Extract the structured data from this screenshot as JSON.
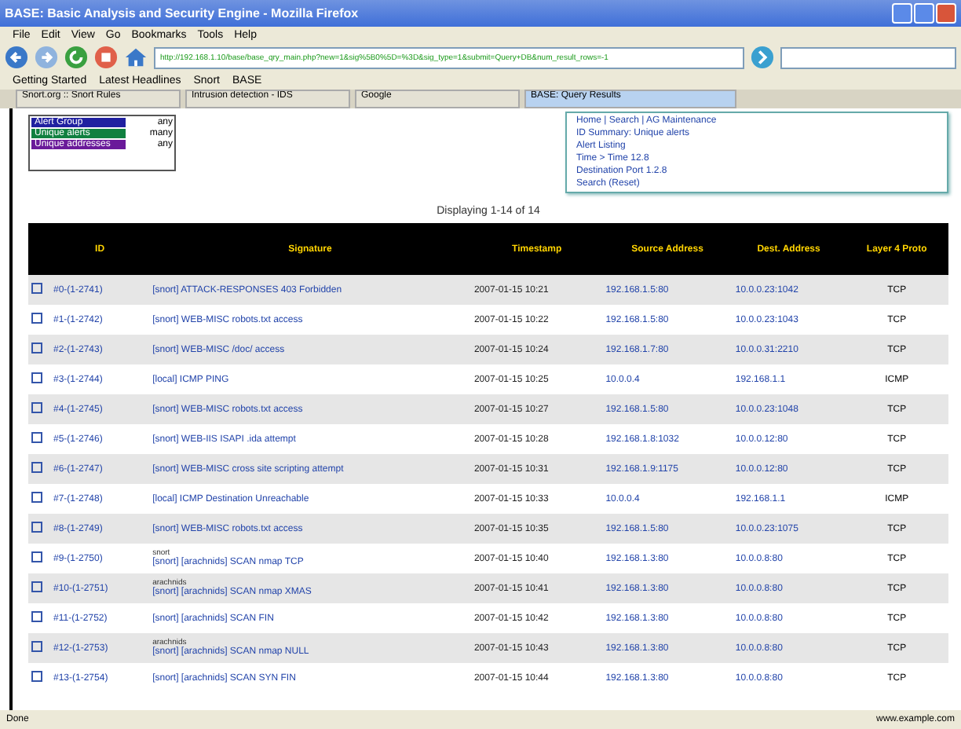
{
  "window": {
    "title": "BASE: Basic Analysis and Security Engine - Mozilla Firefox"
  },
  "menu": [
    "File",
    "Edit",
    "View",
    "Go",
    "Bookmarks",
    "Tools",
    "Help"
  ],
  "address": {
    "value": "http://192.168.1.10/base/base_qry_main.php?new=1&sig%5B0%5D=%3D&sig_type=1&submit=Query+DB&num_result_rows=-1"
  },
  "bookmarks": [
    "Getting Started",
    "Latest Headlines",
    "Snort",
    "BASE"
  ],
  "tabs": [
    {
      "label": "Snort.org :: Snort Rules",
      "selected": false
    },
    {
      "label": "Intrusion detection - IDS",
      "selected": false
    },
    {
      "label": "Google",
      "selected": false
    },
    {
      "label": "BASE: Query Results",
      "selected": true
    }
  ],
  "legend": [
    {
      "label": "Alert Group",
      "value": "any",
      "color": "#2020a0"
    },
    {
      "label": "Unique alerts",
      "value": "many",
      "color": "#108040"
    },
    {
      "label": "Unique addresses",
      "value": "any",
      "color": "#6a1a9a"
    }
  ],
  "nav_links": [
    "Home | Search | AG Maintenance",
    "ID Summary: Unique alerts",
    "Alert Listing",
    "Time > Time 12.8",
    "Destination Port 1.2.8",
    "Search (Reset)"
  ],
  "summary": "Displaying 1-14 of 14",
  "columns": [
    "ID",
    "Signature",
    "Timestamp",
    "Source Address",
    "Dest. Address",
    "Layer 4 Proto"
  ],
  "rows": [
    {
      "checked": false,
      "id": "#0-(1-2741)",
      "note": "",
      "signature": "[snort] ATTACK-RESPONSES 403 Forbidden",
      "timestamp": "2007-01-15 10:21",
      "src": "192.168.1.5:80",
      "dst": "10.0.0.23:1042",
      "proto": "TCP"
    },
    {
      "checked": false,
      "id": "#1-(1-2742)",
      "note": "",
      "signature": "[snort] WEB-MISC robots.txt access",
      "timestamp": "2007-01-15 10:22",
      "src": "192.168.1.5:80",
      "dst": "10.0.0.23:1043",
      "proto": "TCP"
    },
    {
      "checked": false,
      "id": "#2-(1-2743)",
      "note": "",
      "signature": "[snort] WEB-MISC /doc/ access",
      "timestamp": "2007-01-15 10:24",
      "src": "192.168.1.7:80",
      "dst": "10.0.0.31:2210",
      "proto": "TCP"
    },
    {
      "checked": false,
      "id": "#3-(1-2744)",
      "note": "",
      "signature": "[local] ICMP PING",
      "timestamp": "2007-01-15 10:25",
      "src": "10.0.0.4",
      "dst": "192.168.1.1",
      "proto": "ICMP"
    },
    {
      "checked": false,
      "id": "#4-(1-2745)",
      "note": "",
      "signature": "[snort] WEB-MISC robots.txt access",
      "timestamp": "2007-01-15 10:27",
      "src": "192.168.1.5:80",
      "dst": "10.0.0.23:1048",
      "proto": "TCP"
    },
    {
      "checked": false,
      "id": "#5-(1-2746)",
      "note": "",
      "signature": "[snort] WEB-IIS ISAPI .ida attempt",
      "timestamp": "2007-01-15 10:28",
      "src": "192.168.1.8:1032",
      "dst": "10.0.0.12:80",
      "proto": "TCP"
    },
    {
      "checked": false,
      "id": "#6-(1-2747)",
      "note": "",
      "signature": "[snort] WEB-MISC cross site scripting attempt",
      "timestamp": "2007-01-15 10:31",
      "src": "192.168.1.9:1175",
      "dst": "10.0.0.12:80",
      "proto": "TCP"
    },
    {
      "checked": false,
      "id": "#7-(1-2748)",
      "note": "",
      "signature": "[local] ICMP Destination Unreachable",
      "timestamp": "2007-01-15 10:33",
      "src": "10.0.0.4",
      "dst": "192.168.1.1",
      "proto": "ICMP"
    },
    {
      "checked": false,
      "id": "#8-(1-2749)",
      "note": "",
      "signature": "[snort] WEB-MISC robots.txt access",
      "timestamp": "2007-01-15 10:35",
      "src": "192.168.1.5:80",
      "dst": "10.0.0.23:1075",
      "proto": "TCP"
    },
    {
      "checked": false,
      "id": "#9-(1-2750)",
      "note": "snort",
      "signature": "[snort] [arachnids] SCAN nmap TCP",
      "timestamp": "2007-01-15 10:40",
      "src": "192.168.1.3:80",
      "dst": "10.0.0.8:80",
      "proto": "TCP"
    },
    {
      "checked": false,
      "id": "#10-(1-2751)",
      "note": "arachnids",
      "signature": "[snort] [arachnids] SCAN nmap XMAS",
      "timestamp": "2007-01-15 10:41",
      "src": "192.168.1.3:80",
      "dst": "10.0.0.8:80",
      "proto": "TCP"
    },
    {
      "checked": false,
      "id": "#11-(1-2752)",
      "note": "",
      "signature": "[snort] [arachnids] SCAN FIN",
      "timestamp": "2007-01-15 10:42",
      "src": "192.168.1.3:80",
      "dst": "10.0.0.8:80",
      "proto": "TCP"
    },
    {
      "checked": false,
      "id": "#12-(1-2753)",
      "note": "arachnids",
      "signature": "[snort] [arachnids] SCAN nmap NULL",
      "timestamp": "2007-01-15 10:43",
      "src": "192.168.1.3:80",
      "dst": "10.0.0.8:80",
      "proto": "TCP"
    },
    {
      "checked": false,
      "id": "#13-(1-2754)",
      "note": "",
      "signature": "[snort] [arachnids] SCAN SYN FIN",
      "timestamp": "2007-01-15 10:44",
      "src": "192.168.1.3:80",
      "dst": "10.0.0.8:80",
      "proto": "TCP"
    }
  ],
  "status_bar": {
    "left": "Done",
    "right": "www.example.com"
  }
}
